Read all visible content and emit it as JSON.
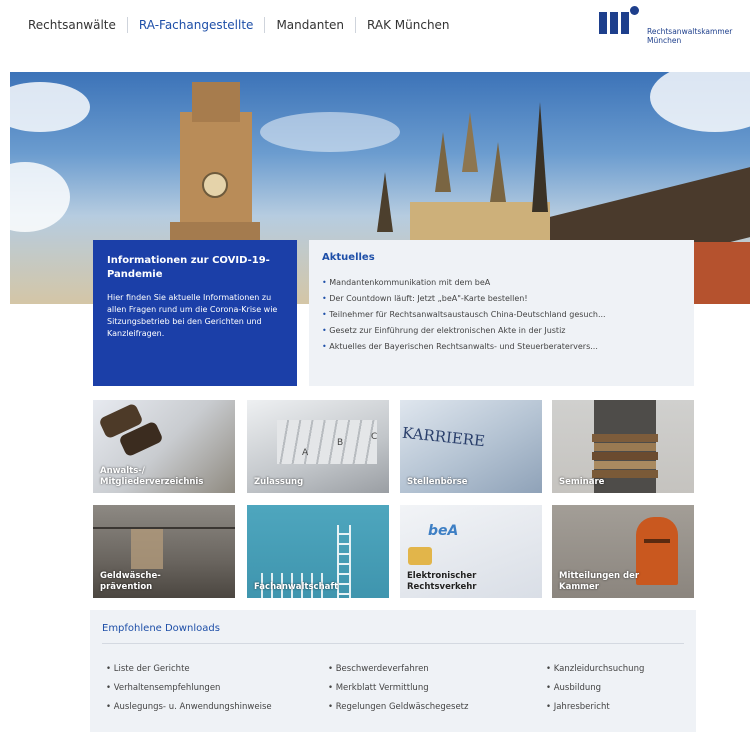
{
  "nav": {
    "items": [
      {
        "label": "Rechtsanwälte",
        "active": false
      },
      {
        "label": "RA-Fachangestellte",
        "active": true
      },
      {
        "label": "Mandanten",
        "active": false
      },
      {
        "label": "RAK München",
        "active": false
      }
    ]
  },
  "logo": {
    "line1": "Rechtsanwaltskammer",
    "line2": "München"
  },
  "covid": {
    "title": "Informationen zur COVID-19-Pandemie",
    "text": "Hier finden Sie aktuelle Informationen zu allen Fragen rund um die Corona-Krise wie Sitzungsbetrieb bei den Gerichten und Kanzleifragen."
  },
  "aktuelles": {
    "title": "Aktuelles",
    "items": [
      "Mandantenkommunikation mit dem beA",
      "Der Countdown läuft: Jetzt „beA\"-Karte bestellen!",
      "Teilnehmer für Rechtsanwaltsaustausch China-Deutschland gesuch...",
      "Gesetz zur Einführung der elektronischen Akte in der Justiz",
      "Aktuelles der Bayerischen Rechtsanwalts- und Steuerberatervers..."
    ]
  },
  "tiles": [
    {
      "label": "Anwalts-/ Mitgliederverzeichnis"
    },
    {
      "label": "Zulassung"
    },
    {
      "label": "Stellenbörse"
    },
    {
      "label": "Seminare"
    },
    {
      "label": "Geldwäsche-prävention"
    },
    {
      "label": "Fachanwaltschaft"
    },
    {
      "label": "Elektronischer Rechtsverkehr"
    },
    {
      "label": "Mitteilungen der Kammer"
    }
  ],
  "tile_art": {
    "stellen_word": "KARRIERE",
    "bea_word": "beA",
    "zulassung_letters": [
      "A",
      "B",
      "C"
    ]
  },
  "downloads": {
    "title": "Empfohlene Downloads",
    "col1": [
      "Liste der Gerichte",
      "Verhaltensempfehlungen",
      "Auslegungs- u. Anwendungshinweise"
    ],
    "col2": [
      "Beschwerdeverfahren",
      "Merkblatt Vermittlung",
      "Regelungen Geldwäschegesetz"
    ],
    "col3": [
      "Kanzleidurchsuchung",
      "Ausbildung",
      "Jahresbericht"
    ]
  },
  "colors": {
    "brand_blue": "#1b3fa8",
    "link_blue": "#1e4fa8",
    "panel_bg": "#eff2f6"
  }
}
